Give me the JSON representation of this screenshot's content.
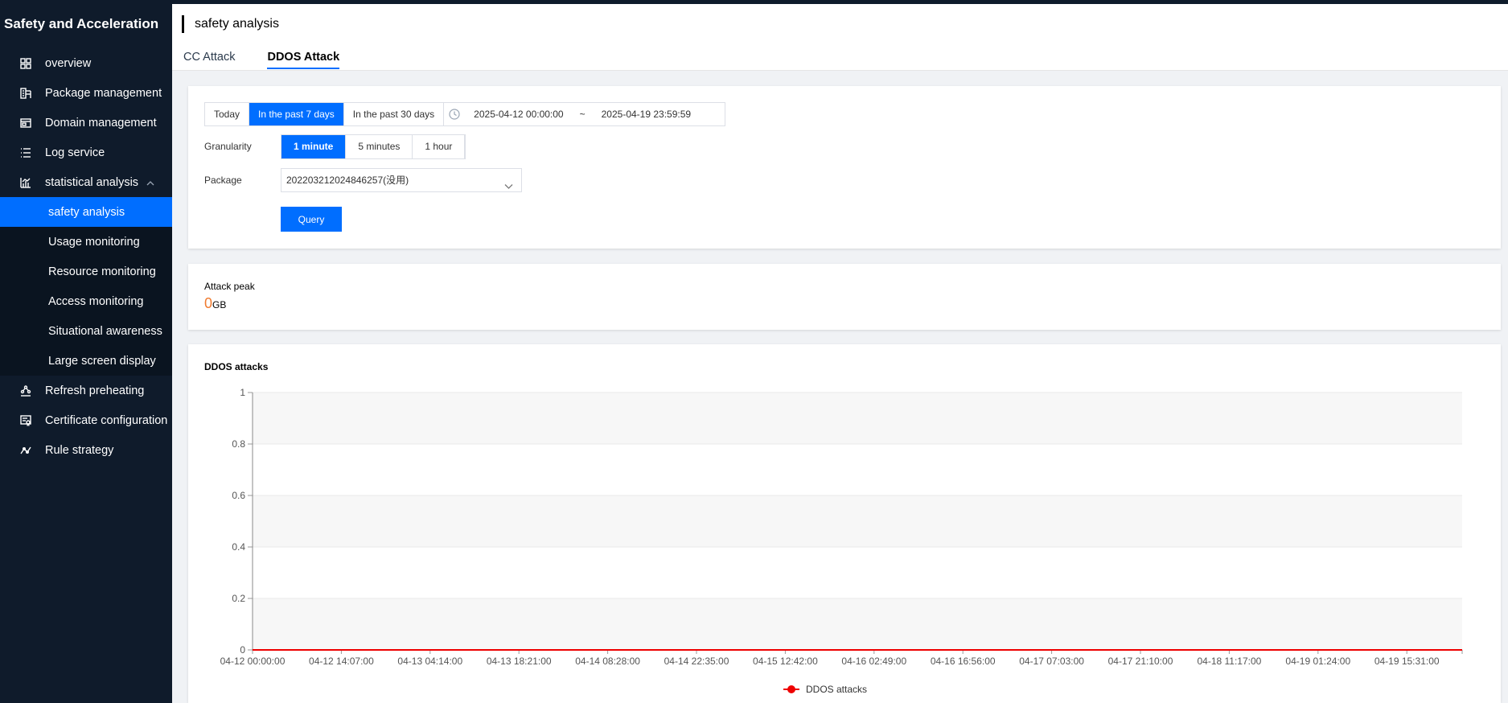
{
  "sidebar": {
    "title": "Safety and Acceleration",
    "items": [
      {
        "label": "overview",
        "icon": "grid-icon"
      },
      {
        "label": "Package management",
        "icon": "package-icon"
      },
      {
        "label": "Domain management",
        "icon": "domain-icon"
      },
      {
        "label": "Log service",
        "icon": "list-icon"
      },
      {
        "label": "statistical analysis",
        "icon": "stats-icon",
        "expanded": true
      },
      {
        "label": "Refresh preheating",
        "icon": "refresh-icon"
      },
      {
        "label": "Certificate configuration",
        "icon": "certificate-icon"
      },
      {
        "label": "Rule strategy",
        "icon": "rule-icon"
      }
    ],
    "submenu": [
      {
        "label": "safety analysis",
        "active": true
      },
      {
        "label": "Usage monitoring"
      },
      {
        "label": "Resource monitoring"
      },
      {
        "label": "Access monitoring"
      },
      {
        "label": "Situational awareness"
      },
      {
        "label": "Large screen display"
      }
    ]
  },
  "header": {
    "title": "safety analysis",
    "tabs": [
      {
        "label": "CC Attack",
        "active": false
      },
      {
        "label": "DDOS Attack",
        "active": true
      }
    ]
  },
  "filters": {
    "time_ranges": [
      "Today",
      "In the past 7 days",
      "In the past 30 days"
    ],
    "active_time_range": "In the past 7 days",
    "start": "2025-04-12 00:00:00",
    "separator": "~",
    "end": "2025-04-19 23:59:59",
    "granularity_label": "Granularity",
    "granularity_options": [
      "1 minute",
      "5 minutes",
      "1 hour"
    ],
    "active_granularity": "1 minute",
    "package_label": "Package",
    "package_value": "202203212024846257(没用)",
    "query_label": "Query"
  },
  "summary": {
    "peak_label": "Attack peak",
    "peak_value": "0",
    "peak_unit": "GB"
  },
  "colors": {
    "accent": "#006eff",
    "sidebar_bg": "#0f1b2b",
    "series": "#ee0000",
    "peak_value": "#f07b2f"
  },
  "chart_data": {
    "type": "line",
    "title": "DDOS attacks",
    "x": [
      "04-12 00:00:00",
      "04-12 14:07:00",
      "04-13 04:14:00",
      "04-13 18:21:00",
      "04-14 08:28:00",
      "04-14 22:35:00",
      "04-15 12:42:00",
      "04-16 02:49:00",
      "04-16 16:56:00",
      "04-17 07:03:00",
      "04-17 21:10:00",
      "04-18 11:17:00",
      "04-19 01:24:00",
      "04-19 15:31:00"
    ],
    "series": [
      {
        "name": "DDOS attacks",
        "values": [
          0,
          0,
          0,
          0,
          0,
          0,
          0,
          0,
          0,
          0,
          0,
          0,
          0,
          0
        ]
      }
    ],
    "yticks": [
      0,
      0.2,
      0.4,
      0.6,
      0.8,
      1
    ],
    "ylim": [
      0,
      1
    ],
    "grid": true,
    "legend": "bottom-center"
  }
}
